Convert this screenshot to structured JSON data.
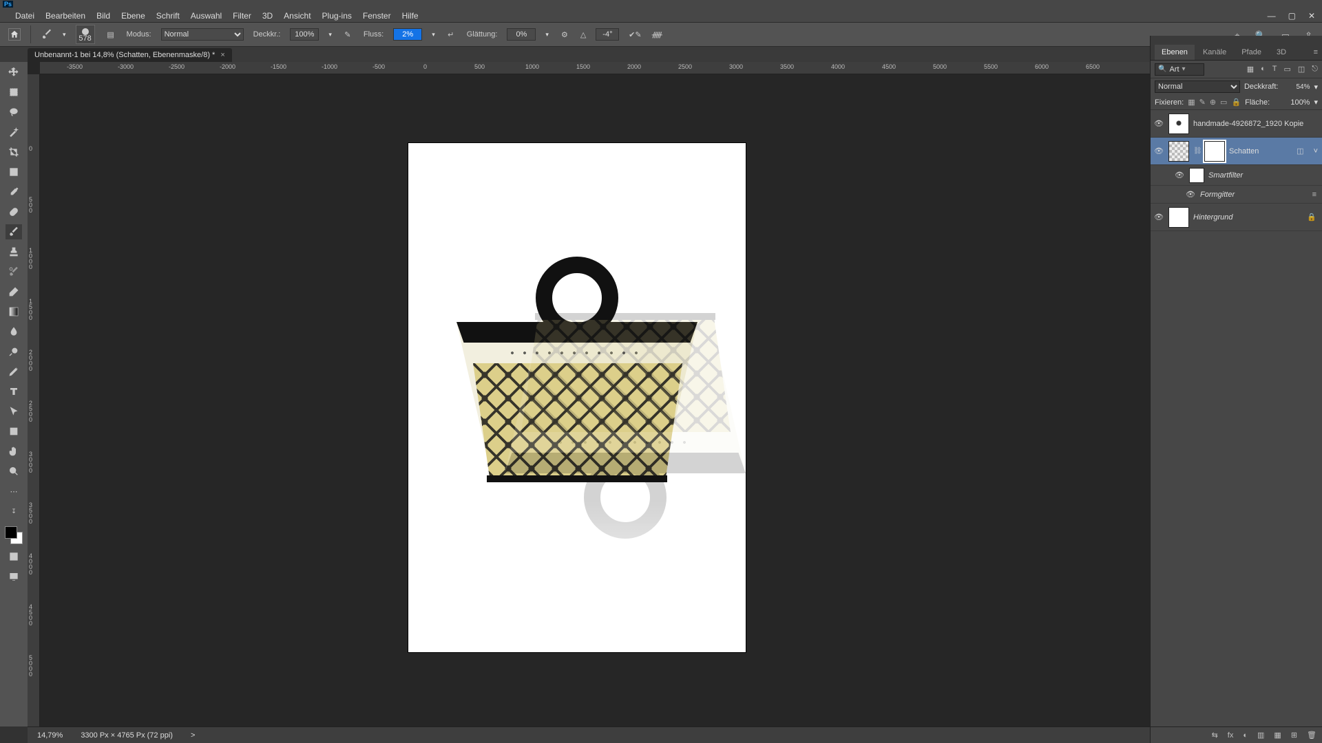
{
  "window": {
    "min": "—",
    "max": "▢",
    "close": "✕"
  },
  "menu": [
    "Datei",
    "Bearbeiten",
    "Bild",
    "Ebene",
    "Schrift",
    "Auswahl",
    "Filter",
    "3D",
    "Ansicht",
    "Plug-ins",
    "Fenster",
    "Hilfe"
  ],
  "optbar": {
    "brush_size": "578",
    "mode_lbl": "Modus:",
    "mode_val": "Normal",
    "opacity_lbl": "Deckkr.:",
    "opacity_val": "100%",
    "flow_lbl": "Fluss:",
    "flow_val": "2%",
    "smooth_lbl": "Glättung:",
    "smooth_val": "0%",
    "angle_lbl": "△",
    "angle_val": "-4°"
  },
  "doc_tab": "Unbenannt-1 bei 14,8% (Schatten, Ebenenmaske/8) *",
  "ruler_h": [
    "-3500",
    "-3000",
    "-2500",
    "-2000",
    "-1500",
    "-1000",
    "-500",
    "0",
    "500",
    "1000",
    "1500",
    "2000",
    "2500",
    "3000",
    "3500",
    "4000",
    "4500",
    "5000",
    "5500",
    "6000",
    "6500"
  ],
  "ruler_v": [
    "0",
    "500",
    "1000",
    "1500",
    "2000",
    "2500",
    "3000",
    "3500",
    "4000",
    "4500",
    "5000"
  ],
  "status": {
    "zoom": "14,79%",
    "dims": "3300 Px × 4765 Px (72 ppi)",
    "more": ">"
  },
  "panel": {
    "tabs": [
      "Ebenen",
      "Kanäle",
      "Pfade",
      "3D"
    ],
    "tab_active": 0,
    "search_placeholder": "Art",
    "blend": "Normal",
    "opacity_lbl": "Deckkraft:",
    "opacity_val": "54%",
    "lock_lbl": "Fixieren:",
    "fill_lbl": "Fläche:",
    "fill_val": "100%"
  },
  "layers": [
    {
      "kind": "img",
      "name": "handmade-4926872_1920 Kopie",
      "sel": false
    },
    {
      "kind": "smart",
      "name": "Schatten",
      "sel": true,
      "mask": true
    },
    {
      "kind": "sf",
      "name": "Smartfilter"
    },
    {
      "kind": "sf2",
      "name": "Formgitter"
    },
    {
      "kind": "bg",
      "name": "Hintergrund",
      "locked": true
    }
  ],
  "layer_foot": [
    "⇆",
    "fx",
    "◐",
    "▥",
    "▦",
    "✎",
    "⊞",
    "🗑"
  ],
  "topright": [
    "�target",
    "🔍",
    "⊞",
    "⇪"
  ]
}
